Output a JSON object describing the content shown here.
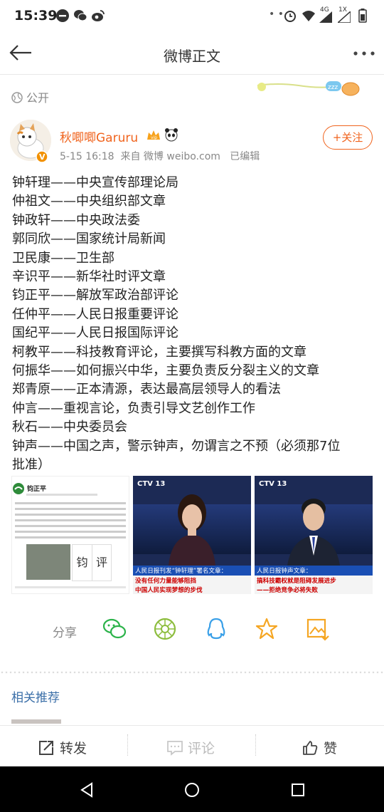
{
  "status_bar": {
    "time": "15:39",
    "network": "4G",
    "network_extra": "1X"
  },
  "header": {
    "title": "微博正文",
    "back_icon": "arrow-left-icon",
    "more_icon": "more-dots-icon"
  },
  "visibility": {
    "label": "公开"
  },
  "post": {
    "author": "秋唧唧Garuru",
    "date": "5-15 16:18",
    "source": "来自 微博 weibo.com",
    "edited": "已编辑",
    "follow_label": "+关注",
    "lines": [
      "钟轩理——中央宣传部理论局",
      "仲祖文——中央组织部文章",
      "钟政轩——中央政法委",
      "郭同欣——国家统计局新闻",
      "卫民康——卫生部",
      "辛识平——新华社时评文章",
      "钧正平——解放军政治部评论",
      "任仲平——人民日报重要评论",
      "国纪平——人民日报国际评论",
      "柯教平——科技教育评论，主要撰写科教方面的文章",
      "何振华——如何振兴中华，主要负责反分裂主义的文章",
      "郑青原——正本清源，表达最高层领导人的看法",
      "仲言——重视言论，负责引导文艺创作工作",
      "秋石——中央委员会",
      "钟声——中国之声，警示钟声，勿谓言之不预（必须那7位",
      "批准）"
    ],
    "images": [
      {
        "kind": "screenshot",
        "name": "钧正平",
        "tile1": "钧",
        "tile2": "评"
      },
      {
        "kind": "news",
        "logo": "CTV 13",
        "caption1": "人民日报刊发“钟轩理”署名文章：",
        "caption2": "没有任何力量能够阻挡",
        "caption3": "中国人民实现梦想的步伐"
      },
      {
        "kind": "news",
        "logo": "CTV 13",
        "caption1": "人民日报钟声文章：",
        "caption2": "搞科技霸权就是阻碍发展进步",
        "caption3": "——拒绝竞争必将失败"
      }
    ]
  },
  "share": {
    "label": "分享",
    "icons": [
      "wechat-icon",
      "moments-icon",
      "qq-icon",
      "favorite-star-icon",
      "save-image-icon"
    ]
  },
  "related": {
    "label": "相关推荐"
  },
  "bottom_bar": {
    "repost": "转发",
    "comment": "评论",
    "like": "赞"
  },
  "colors": {
    "accent": "#f0641e",
    "link": "#3b6fa8",
    "share_green": "#2cb34a",
    "share_blue": "#3aa0e8",
    "share_yellow": "#f5a623"
  }
}
